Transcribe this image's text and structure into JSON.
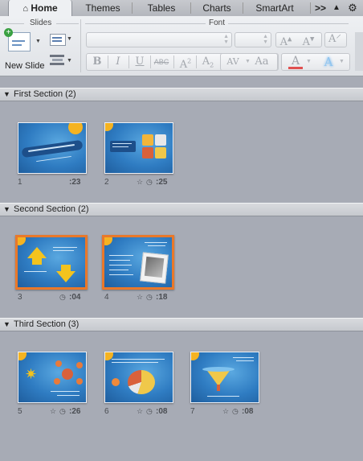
{
  "tabs": [
    {
      "label": "Home",
      "active": true
    },
    {
      "label": "Themes"
    },
    {
      "label": "Tables"
    },
    {
      "label": "Charts"
    },
    {
      "label": "SmartArt"
    }
  ],
  "tab_more": ">>",
  "ribbon": {
    "slides_group": "Slides",
    "font_group": "Font",
    "new_slide_label": "New Slide"
  },
  "sections": [
    {
      "title": "First Section (2)",
      "collapsed": false
    },
    {
      "title": "Second Section (2)",
      "collapsed": false
    },
    {
      "title": "Third Section (3)",
      "collapsed": false
    }
  ],
  "slides": [
    {
      "num": "1",
      "time": ":23",
      "has_icons": false,
      "selected": false
    },
    {
      "num": "2",
      "time": ":25",
      "has_icons": true,
      "selected": false
    },
    {
      "num": "3",
      "time": ":04",
      "has_icons": true,
      "selected": true
    },
    {
      "num": "4",
      "time": ":18",
      "has_icons": true,
      "selected": true
    },
    {
      "num": "5",
      "time": ":26",
      "has_icons": true,
      "selected": false
    },
    {
      "num": "6",
      "time": ":08",
      "has_icons": true,
      "selected": false
    },
    {
      "num": "7",
      "time": ":08",
      "has_icons": true,
      "selected": false
    }
  ],
  "colors": {
    "selection": "#e9782a",
    "slide_blue": "#2a74b7",
    "accent_orange": "#f5b321"
  }
}
